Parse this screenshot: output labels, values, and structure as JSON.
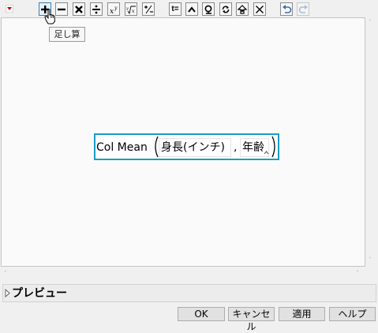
{
  "toolbar": {
    "buttons": [
      "add",
      "subtract",
      "multiply",
      "divide",
      "power",
      "root",
      "plus-minus",
      "assign",
      "peel",
      "local-variable",
      "swap",
      "insert",
      "delete",
      "undo",
      "redo"
    ],
    "icons": {
      "root": "√",
      "assign": "t="
    },
    "tooltip": "足し算"
  },
  "formula": {
    "function_name": "Col Mean",
    "arg1": "身長(インチ)",
    "separator": ",",
    "arg2": "年齢"
  },
  "preview": {
    "label": "プレビュー"
  },
  "buttons": {
    "ok": "OK",
    "cancel": "キャンセル",
    "apply": "適用",
    "help": "ヘルプ"
  },
  "colors": {
    "formula_border": "#1b9bc6",
    "menu_triangle": "#cc0000",
    "undo_active": "#3a6fb0"
  }
}
